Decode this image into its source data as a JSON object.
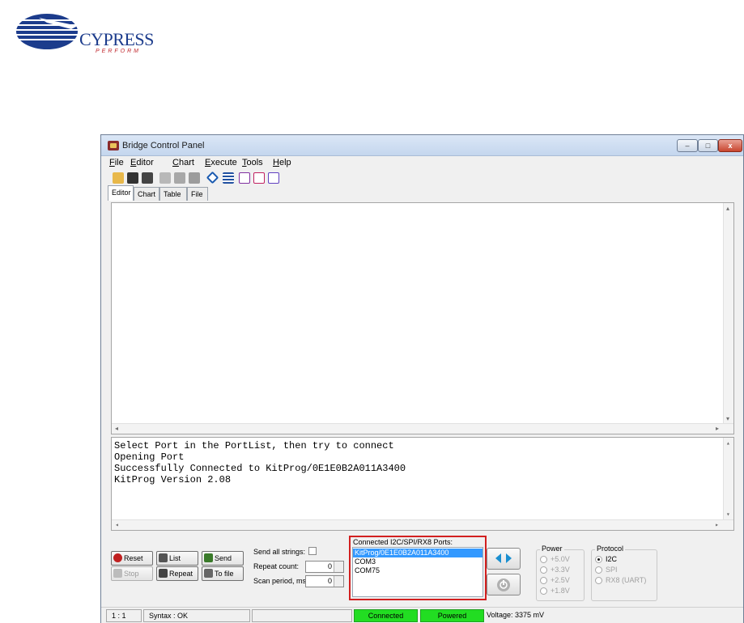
{
  "logo": {
    "wordmark": "CYPRESS",
    "tagline": "PERFORM"
  },
  "window": {
    "title": "Bridge Control Panel",
    "controls": {
      "minimize": "–",
      "maximize": "□",
      "close": "x"
    }
  },
  "menu": [
    {
      "key": "F",
      "rest": "ile"
    },
    {
      "key": "E",
      "rest": "ditor"
    },
    {
      "key": "C",
      "rest": "hart"
    },
    {
      "key": "E",
      "rest": "xecute"
    },
    {
      "key": "T",
      "rest": "ools"
    },
    {
      "key": "H",
      "rest": "elp"
    }
  ],
  "tabs": [
    "Editor",
    "Chart",
    "Table",
    "File"
  ],
  "log": {
    "lines": [
      "Select Port in the PortList, then try to connect",
      "Opening Port",
      "Successfully Connected to KitProg/0E1E0B2A011A3400",
      "KitProg Version 2.08"
    ]
  },
  "buttons": {
    "reset": "Reset",
    "list": "List",
    "send": "Send",
    "stop": "Stop",
    "repeat": "Repeat",
    "to_file": "To file"
  },
  "options": {
    "send_all_label": "Send all strings:",
    "repeat_label": "Repeat count:",
    "repeat_value": "0",
    "scan_label": "Scan period, ms:",
    "scan_value": "0"
  },
  "ports": {
    "label": "Connected I2C/SPI/RX8 Ports:",
    "items": [
      "KitProg/0E1E0B2A011A3400",
      "COM3",
      "COM75"
    ],
    "selected": "KitProg/0E1E0B2A011A3400"
  },
  "power": {
    "label": "Power",
    "options": [
      "+5.0V",
      "+3.3V",
      "+2.5V",
      "+1.8V"
    ]
  },
  "protocol": {
    "label": "Protocol",
    "options": [
      "I2C",
      "SPI",
      "RX8 (UART)"
    ],
    "selected": "I2C"
  },
  "status": {
    "position": "1 : 1",
    "syntax": "Syntax : OK",
    "connected": "Connected",
    "powered": "Powered",
    "voltage": "Voltage: 3375 mV"
  },
  "colors": {
    "status_green": "#22dd22",
    "highlight_red": "#d22020",
    "selection_blue": "#3399ff"
  }
}
